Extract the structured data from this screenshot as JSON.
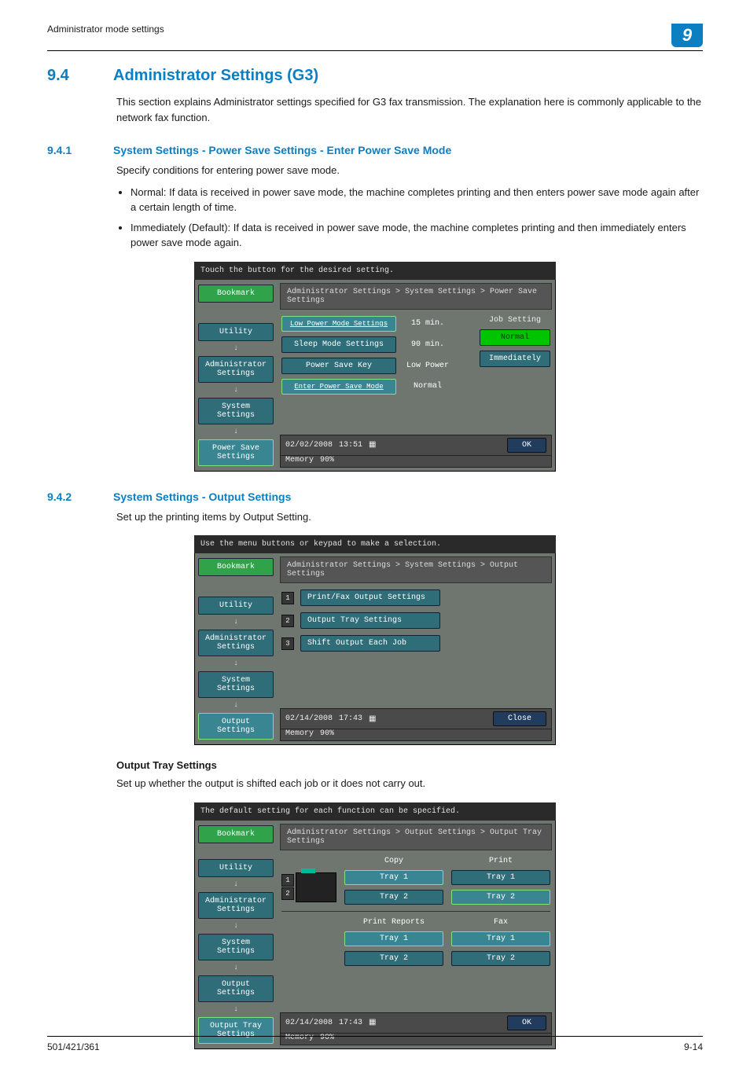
{
  "doc": {
    "running_head": "Administrator mode settings",
    "chapter_number": "9",
    "footer_left": "501/421/361",
    "footer_right": "9-14",
    "sec": {
      "num": "9.4",
      "title": "Administrator Settings (G3)"
    },
    "sec_intro": "This section explains Administrator settings specified for G3 fax transmission. The explanation here is commonly applicable to the network fax function.",
    "sub1": {
      "num": "9.4.1",
      "title": "System Settings - Power Save Settings - Enter Power Save Mode",
      "lead": "Specify conditions for entering power save mode.",
      "bullets": [
        "Normal: If data is received in power save mode, the machine completes printing and then enters power save mode again after a certain length of time.",
        "Immediately (Default): If data is received in power save mode, the machine completes printing and then immediately enters power save mode again."
      ]
    },
    "sub2": {
      "num": "9.4.2",
      "title": "System Settings - Output Settings",
      "lead": "Set up the printing items by Output Setting.",
      "minor": "Output Tray Settings",
      "minor_lead": "Set up whether the output is shifted each job or it does not carry out."
    }
  },
  "panel_common": {
    "bookmark": "Bookmark",
    "utility": "Utility",
    "admin": "Administrator Settings",
    "system": "System Settings",
    "ok": "OK",
    "close": "Close",
    "memory": "Memory",
    "mem_pct": "90%"
  },
  "panel1": {
    "topbar": "Touch the button for the desired setting.",
    "crumb": "Administrator Settings > System Settings > Power Save Settings",
    "side_last": "Power Save Settings",
    "rows": {
      "low_power_label": "Low Power Mode Settings",
      "low_power_val": "15 min.",
      "sleep_label": "Sleep Mode Settings",
      "sleep_val": "90 min.",
      "power_key_label": "Power Save Key",
      "power_key_val": "Low Power",
      "enter_label": "Enter Power Save Mode",
      "enter_val": "Normal"
    },
    "side": {
      "title": "Job Setting",
      "normal": "Normal",
      "immediately": "Immediately"
    },
    "status_date": "02/02/2008",
    "status_time": "13:51"
  },
  "panel2": {
    "topbar": "Use the menu buttons or keypad to make a selection.",
    "crumb": "Administrator Settings > System Settings > Output Settings",
    "side_last": "Output Settings",
    "items": {
      "n1": "1",
      "l1": "Print/Fax Output Settings",
      "n2": "2",
      "l2": "Output Tray Settings",
      "n3": "3",
      "l3": "Shift Output Each Job"
    },
    "status_date": "02/14/2008",
    "status_time": "17:43"
  },
  "panel3": {
    "topbar": "The default setting for each function can be specified.",
    "crumb": "Administrator Settings > Output Settings > Output Tray Settings",
    "side_extra": "Output Settings",
    "side_last": "Output Tray Settings",
    "heads": {
      "copy": "Copy",
      "print": "Print",
      "reports": "Print Reports",
      "fax": "Fax"
    },
    "nums": {
      "one": "1",
      "two": "2"
    },
    "trays": {
      "t1": "Tray 1",
      "t2": "Tray 2"
    },
    "status_date": "02/14/2008",
    "status_time": "17:43"
  }
}
